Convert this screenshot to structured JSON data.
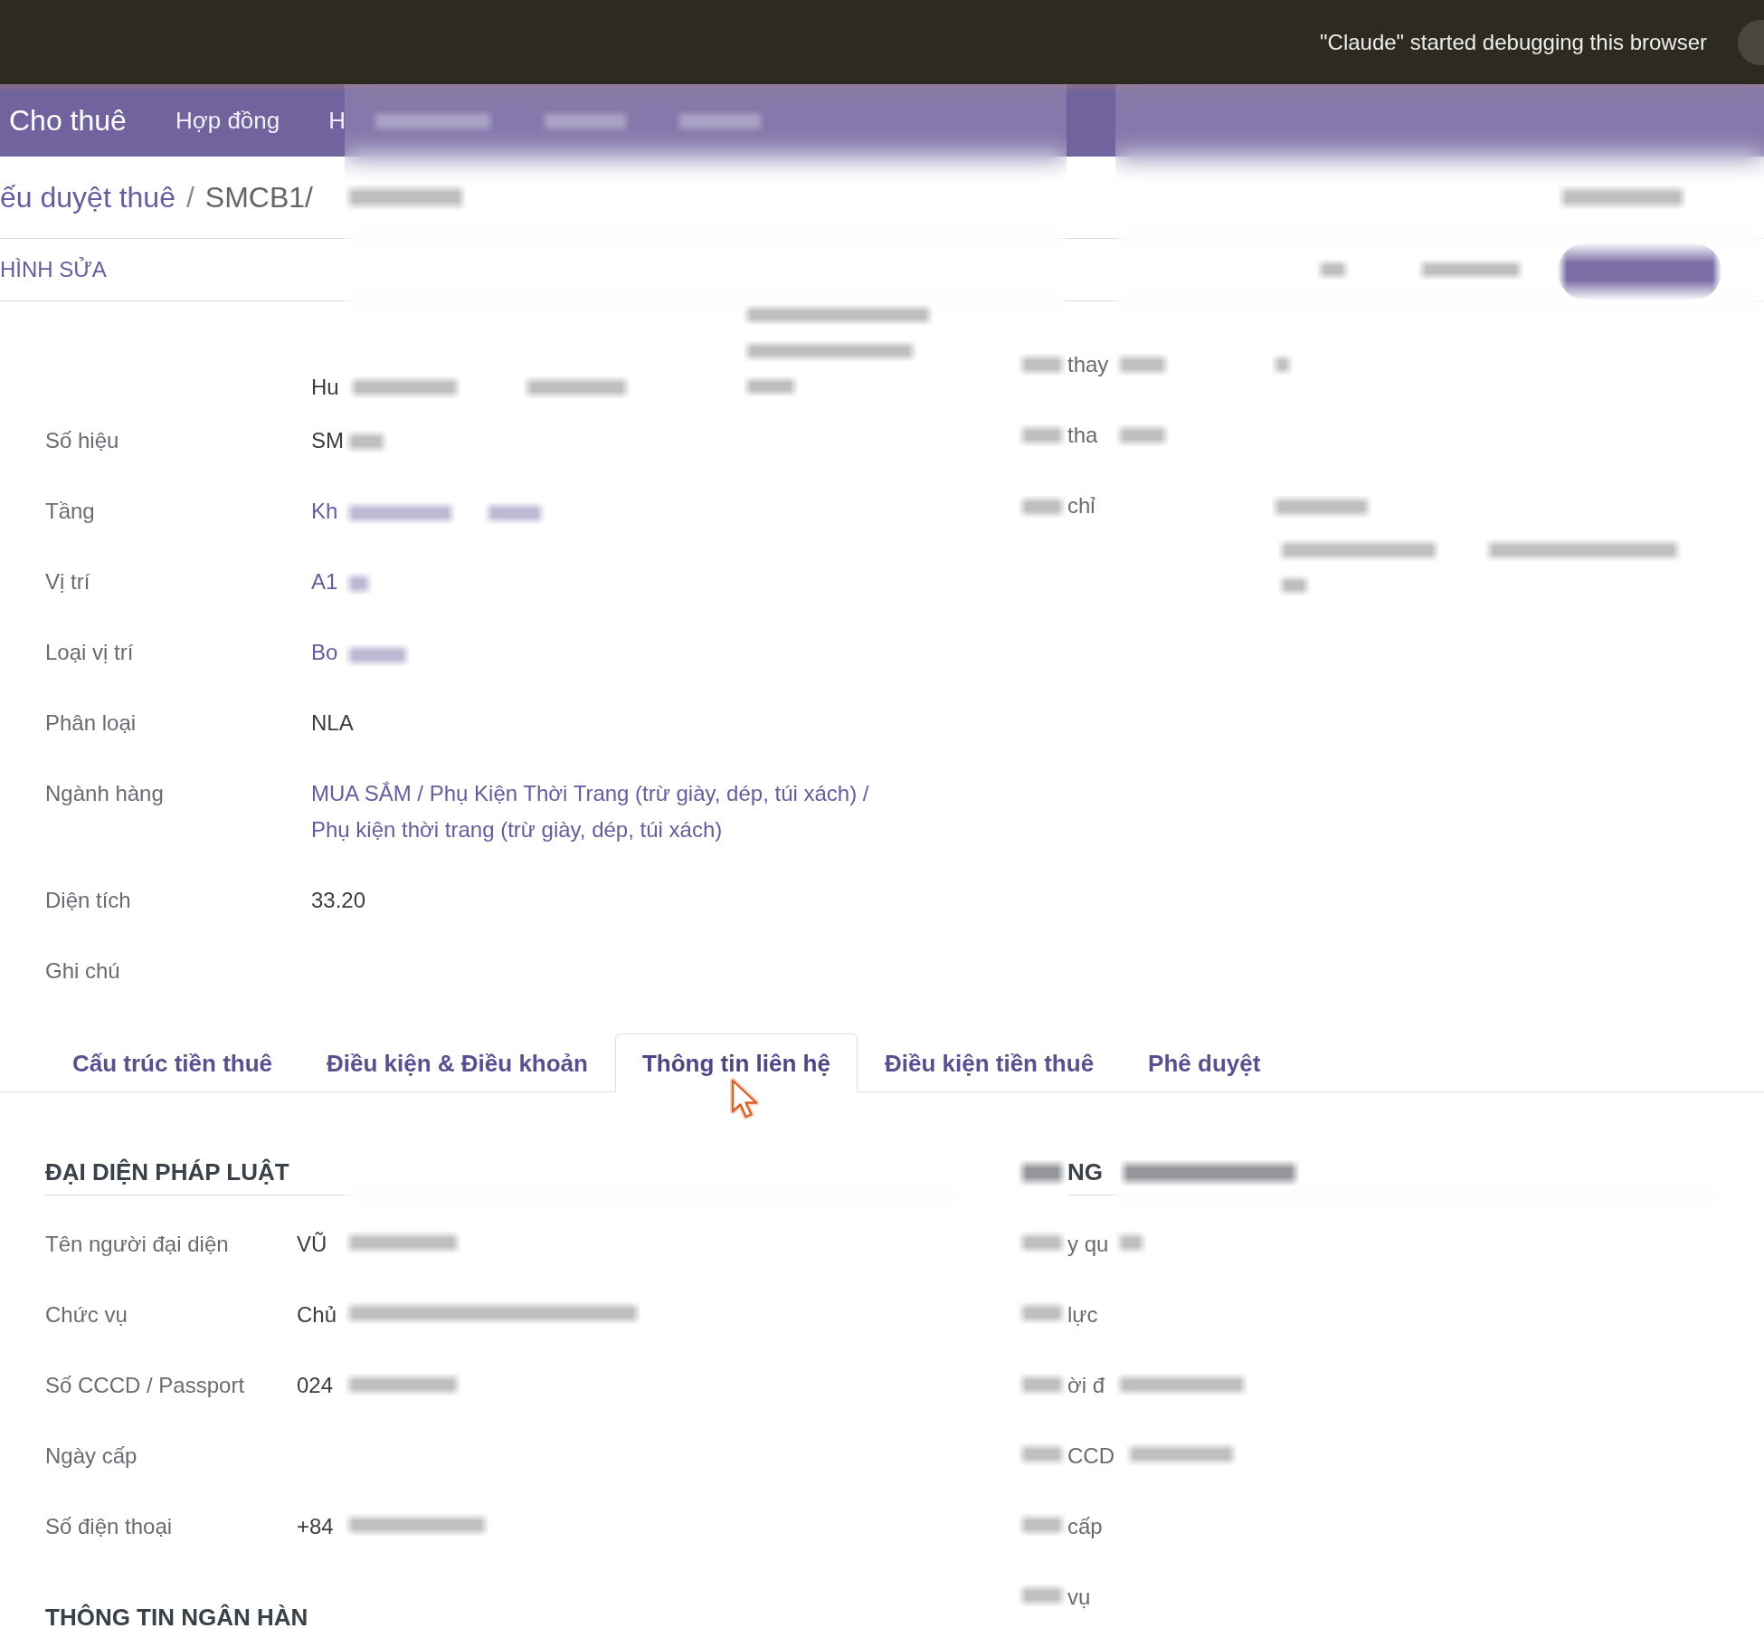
{
  "browser_banner": {
    "message": "\"Claude\" started debugging this browser"
  },
  "nav_bar": {
    "app_name": "Cho thuê",
    "menu_items": [
      "Hợp đồng",
      "H"
    ]
  },
  "breadcrumb": {
    "items": [
      "ếu duyệt thuê",
      "SMCB1/"
    ],
    "separator": "/"
  },
  "toolbar": {
    "edit_button": "HÌNH SỬA"
  },
  "form": {
    "left_fields": [
      {
        "kind": "text",
        "value": "Hu"
      },
      {
        "label": "Số hiệu",
        "kind": "text",
        "value": "SM"
      },
      {
        "label": "Tầng",
        "kind": "link",
        "value": "Kh"
      },
      {
        "label": "Vị trí",
        "kind": "link",
        "value": "A1"
      },
      {
        "label": "Loại vị trí",
        "kind": "link",
        "value": "Bo"
      },
      {
        "label": "Phân loại",
        "kind": "text",
        "value": "NLA"
      },
      {
        "label": "Ngành hàng",
        "kind": "link",
        "value": "MUA SẮM / Phụ Kiện Thời Trang (trừ giày, dép, túi xách) / Phụ kiện thời trang (trừ giày, dép, túi xách)"
      },
      {
        "label": "Diện tích",
        "kind": "text",
        "value": "33.20"
      },
      {
        "label": "Ghi chú"
      }
    ],
    "right_fields": [
      {
        "label": "thay"
      },
      {
        "label": "tha"
      },
      {
        "label": "chỉ"
      }
    ]
  },
  "tabs": [
    {
      "label": "Cấu trúc tiền thuê",
      "selected": false
    },
    {
      "label": "Điều kiện & Điều khoản",
      "selected": false
    },
    {
      "label": "Thông tin liên hệ",
      "selected": true
    },
    {
      "label": "Điều kiện tiền thuê",
      "selected": false
    },
    {
      "label": "Phê duyệt",
      "selected": false
    }
  ],
  "contact": {
    "left_sections": [
      {
        "title": "ĐẠI DIỆN PHÁP LUẬT",
        "fields": [
          {
            "label": "Tên người đại diện",
            "kind": "text",
            "value": "VŨ"
          },
          {
            "label": "Chức vụ",
            "kind": "text",
            "value": "Chủ"
          },
          {
            "label": "Số CCCD / Passport",
            "kind": "text",
            "value": "024"
          },
          {
            "label": "Ngày cấp"
          },
          {
            "label": "Số điện thoại",
            "kind": "text",
            "value": "+84"
          }
        ]
      },
      {
        "title": "THÔNG TIN NGÂN HÀN"
      }
    ],
    "right_sections": [
      {
        "title": "NG",
        "fields": [
          {
            "label": "y qu"
          },
          {
            "label": "lực"
          },
          {
            "label": "ời đ"
          },
          {
            "label": "CCD"
          },
          {
            "label": "cấp"
          },
          {
            "label": "vụ"
          }
        ]
      }
    ]
  }
}
